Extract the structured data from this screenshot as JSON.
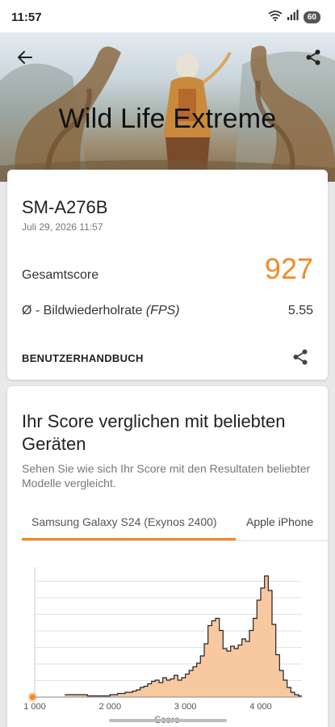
{
  "status": {
    "time": "11:57",
    "battery": "60"
  },
  "hero": {
    "title": "Wild Life Extreme"
  },
  "result": {
    "device": "SM-A276B",
    "date": "Juli 29, 2026 11:57",
    "score_label": "Gesamtscore",
    "score": "927",
    "fps_label_prefix": "Ø - Bildwiederholrate ",
    "fps_label_unit": "(FPS)",
    "fps": "5.55",
    "manual": "BENUTZERHANDBUCH"
  },
  "compare": {
    "title": "Ihr Score verglichen mit beliebten Geräten",
    "subtitle": "Sehen Sie wie sich Ihr Score mit den Resultaten beliebter Modelle vergleicht.",
    "tabs": [
      "Samsung Galaxy S24 (Exynos 2400)",
      "Apple iPhone"
    ]
  },
  "colors": {
    "accent": "#f08a2a",
    "fill": "#f8c9a0"
  },
  "chart_data": {
    "type": "area",
    "xlabel": "Score",
    "ylabel": "",
    "xlim": [
      1000,
      4500
    ],
    "ylim": [
      0,
      100
    ],
    "xticks": [
      "1 000",
      "2 000",
      "3 000",
      "4 000"
    ],
    "xtick_values": [
      1000,
      2000,
      3000,
      4000
    ],
    "grid": true,
    "marker": {
      "name": "Ihr Score",
      "x": 927
    },
    "series": [
      {
        "x": [
          1400,
          1550,
          1700,
          1800,
          1900,
          2000,
          2100,
          2150,
          2200,
          2250,
          2300,
          2350,
          2400,
          2450,
          2500,
          2550,
          2600,
          2650,
          2700,
          2750,
          2800,
          2850,
          2900,
          2950,
          3000,
          3050,
          3100,
          3150,
          3200,
          3250,
          3300,
          3350,
          3400,
          3450,
          3500,
          3550,
          3600,
          3650,
          3700,
          3750,
          3800,
          3850,
          3900,
          3950,
          4000,
          4050,
          4100,
          4150,
          4200,
          4250,
          4300,
          4350,
          4400,
          4450,
          4500
        ],
        "y": [
          2,
          2,
          1,
          1,
          1,
          2,
          3,
          3,
          4,
          4,
          5,
          6,
          8,
          9,
          11,
          13,
          14,
          12,
          16,
          14,
          15,
          18,
          14,
          16,
          19,
          22,
          25,
          28,
          34,
          44,
          59,
          63,
          65,
          55,
          40,
          38,
          42,
          40,
          43,
          48,
          46,
          55,
          65,
          80,
          90,
          100,
          88,
          60,
          35,
          22,
          14,
          8,
          4,
          2,
          1
        ]
      }
    ]
  }
}
